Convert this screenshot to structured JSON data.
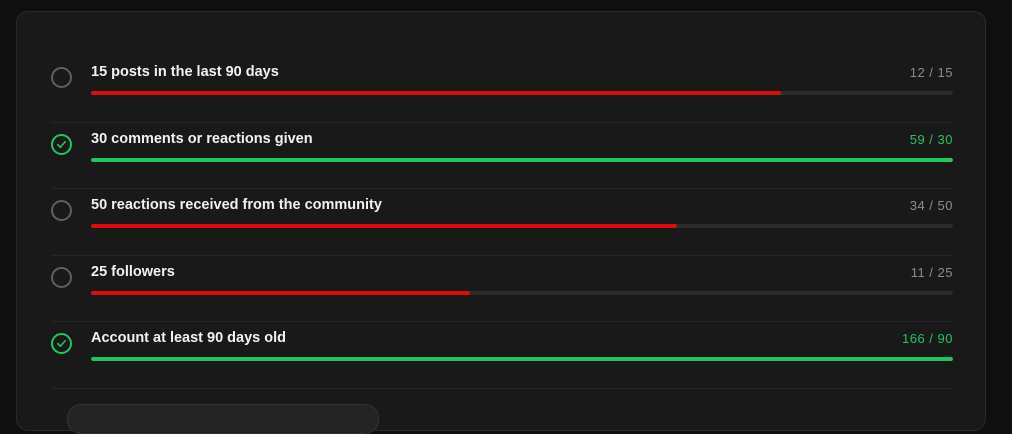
{
  "requirements": [
    {
      "label": "15 posts in the last 90 days",
      "count": "12 / 15",
      "current": 12,
      "target": 15,
      "progress": 0.8,
      "met": false
    },
    {
      "label": "30 comments or reactions given",
      "count": "59 / 30",
      "current": 59,
      "target": 30,
      "progress": 1.0,
      "met": true
    },
    {
      "label": "50 reactions received from the community",
      "count": "34 / 50",
      "current": 34,
      "target": 50,
      "progress": 0.68,
      "met": false
    },
    {
      "label": "25 followers",
      "count": "11 / 25",
      "current": 11,
      "target": 25,
      "progress": 0.44,
      "met": false
    },
    {
      "label": "Account at least 90 days old",
      "count": "166 / 90",
      "current": 166,
      "target": 90,
      "progress": 1.0,
      "met": true
    }
  ],
  "colors": {
    "met": "#22c55e",
    "unmet": "#e00b0b",
    "track": "#2b2b2b"
  },
  "icons": {
    "met": "check-circle-icon",
    "unmet": "empty-circle-icon"
  }
}
